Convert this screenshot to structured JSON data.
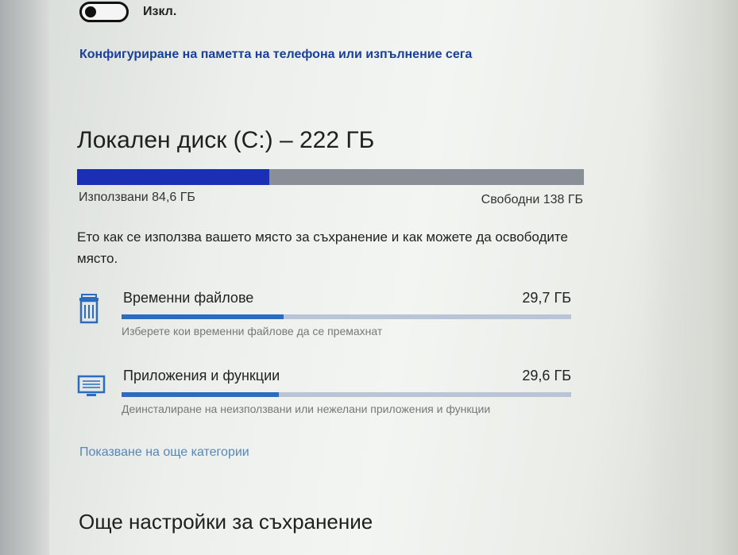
{
  "storage_sense": {
    "toggle_state": "off",
    "toggle_label": "Изкл.",
    "config_link": "Конфигуриране на паметта на телефона или изпълнение сега"
  },
  "disk": {
    "title": "Локален диск (C:) – 222 ГБ",
    "used_label": "Използвани 84,6 ГБ",
    "free_label": "Свободни 138 ГБ",
    "used_fraction": 0.38,
    "used_color": "#1b2fb4",
    "free_color": "#8a8e96"
  },
  "description": "Ето как се използва вашето място за съхранение и как можете да освободите място.",
  "categories": [
    {
      "icon": "trash-icon",
      "name": "Временни файлове",
      "size": "29,7 ГБ",
      "fill_fraction": 0.36,
      "description": "Изберете кои временни файлове да се премахнат"
    },
    {
      "icon": "monitor-icon",
      "name": "Приложения и функции",
      "size": "29,6 ГБ",
      "fill_fraction": 0.35,
      "description": "Деинсталиране на неизползвани или нежелани приложения и функции"
    }
  ],
  "show_more_link": "Показване на още категории",
  "more_settings_heading": "Още настройки за съхранение",
  "colors": {
    "link": "#1a3f9b",
    "accent": "#2c6cc0"
  }
}
